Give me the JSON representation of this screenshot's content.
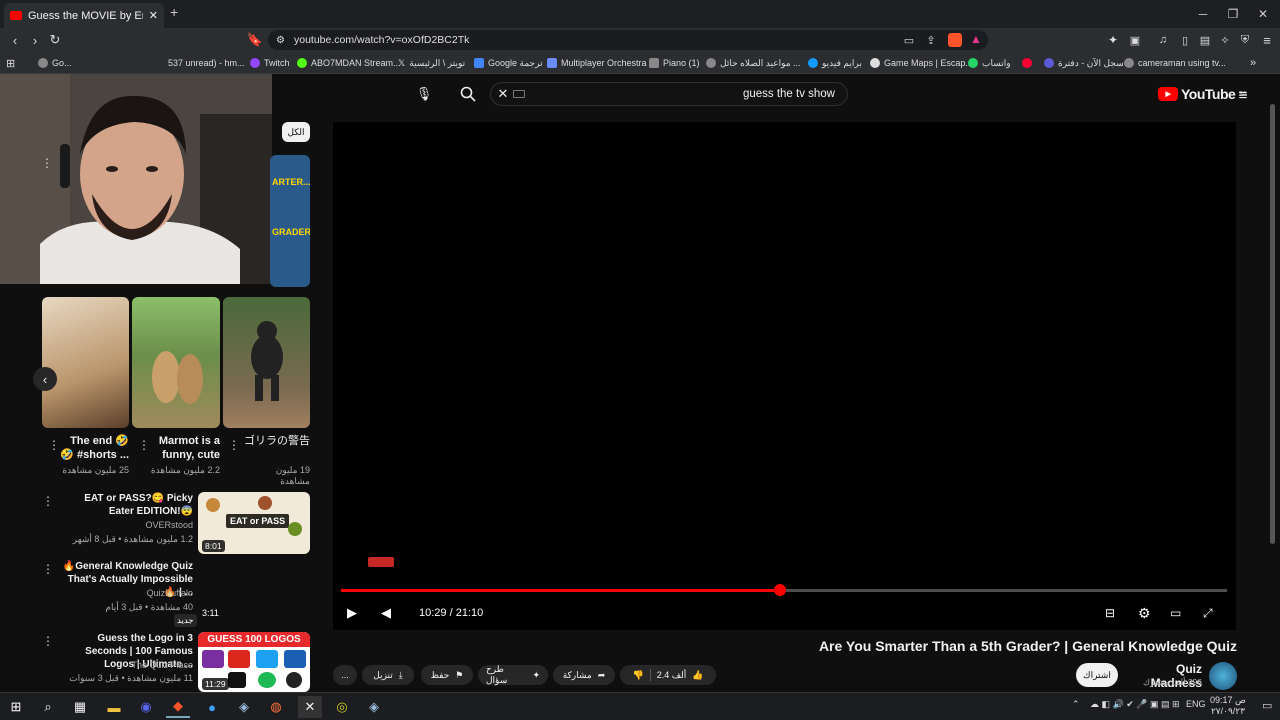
{
  "browser": {
    "tab_title": "Guess the MOVIE by Emoji Quiz",
    "url": "youtube.com/watch?v=oxOfD2BC2Tk",
    "bookmarks": [
      "Go...",
      "537 unread) - hm...",
      "Twitch",
      "ABO7MDAN Stream...",
      "تويتر \\ الرئيسية",
      "Google ترجمة",
      "Multiplayer Orchestra",
      "Piano (1)",
      "مواعيد الصلاه حائل ...",
      "برايم فيديو",
      "Game Maps | Escap...",
      "واتساب",
      "سجل الآن - دفترة",
      "cameraman using tv..."
    ]
  },
  "youtube": {
    "search_value": "guess the tv show",
    "logo": "YouTube",
    "logo_region": "SA",
    "filter_chip": "الكل",
    "video_title": "Are You Smarter Than a 5th Grader? | General Knowledge Quiz",
    "time": "10:29 / 21:10",
    "progress": 0.496,
    "channel": "Quiz Madness",
    "subscribers": "296 ألف مشترك",
    "subscribe_label": "اشتراك",
    "actions": {
      "like_count": "2.4 ألف",
      "share": "مشاركة",
      "ask": "طرح سؤال",
      "save": "حفظ",
      "download": "تنزيل",
      "more": "..."
    },
    "shorts": [
      {
        "title": "The end 🤣🤣 #shorts ...",
        "views": "25 مليون مشاهدة"
      },
      {
        "title": "Marmot is a funny, cute ...",
        "views": "2.2 مليون مشاهدة"
      },
      {
        "title": "ゴリラの警告",
        "views": "19 مليون مشاهدة"
      }
    ],
    "recommended": [
      {
        "title": "EAT or PASS?😋 Picky Eater EDITION!😨",
        "channel": "OVERstood",
        "meta": "1.2 مليون مشاهدة • قبل 8 أشهر",
        "duration": "8:01",
        "thumb_text": "EAT or PASS"
      },
      {
        "title": "🔥General Knowledge Quiz That's Actually Impossible🔥 | ...",
        "channel": "QuizBuffalo",
        "meta": "40 مشاهدة • قبل 3 أيام",
        "duration": "3:11",
        "tag": "جديد"
      },
      {
        "title": "Guess the Logo in 3 Seconds | 100 Famous Logos | Ultimate ...",
        "channel": "The Quiz Place",
        "meta": "11 مليون مشاهدة • قبل 3 سنوات",
        "duration": "11:29",
        "thumb_text": "GUESS 100 LOGOS"
      }
    ],
    "partial_thumb_text": "ARTER... GRADER?"
  },
  "taskbar": {
    "lang": "ENG",
    "time": "09:17 ص",
    "date": "٢٧/٠٩/٢٣"
  },
  "colors": {
    "accent": "#ff0000",
    "bg": "#0f0f0f"
  }
}
